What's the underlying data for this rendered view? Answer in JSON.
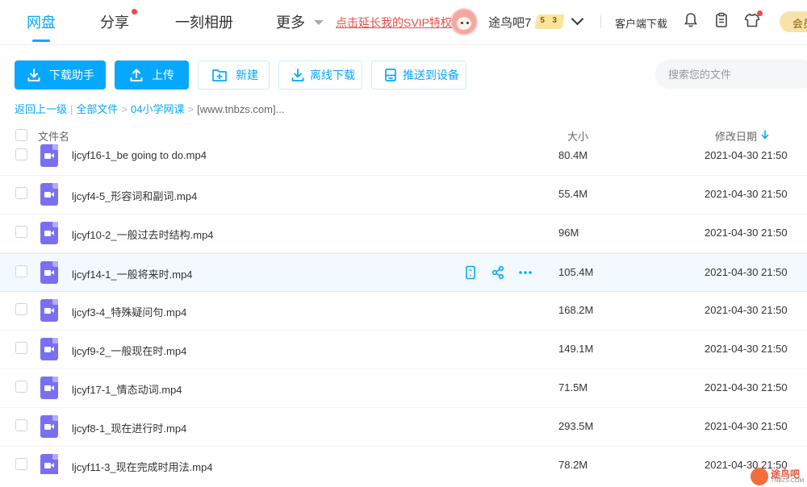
{
  "nav": {
    "items": [
      "网盘",
      "分享",
      "一刻相册",
      "更多"
    ],
    "svip_link": "点击延长我的SVIP特权"
  },
  "user": {
    "name": "途鸟吧7",
    "badge_level_a": "5",
    "badge_level_b": "3"
  },
  "header": {
    "client_download": "客户端下载",
    "member_label": "会员"
  },
  "toolbar": {
    "download_helper": "下载助手",
    "upload": "上传",
    "new": "新建",
    "offline_download": "离线下载",
    "push_device": "推送到设备"
  },
  "search": {
    "placeholder": "搜索您的文件"
  },
  "breadcrumb": {
    "back": "返回上一级",
    "all_files": "全部文件",
    "folder": "04小学网课",
    "current": "[www.tnbzs.com]..."
  },
  "columns": {
    "name": "文件名",
    "size": "大小",
    "modified": "修改日期"
  },
  "files": [
    {
      "name": "ljcyf16-1_be going to do.mp4",
      "size": "80.4M",
      "date": "2021-04-30 21:50"
    },
    {
      "name": "ljcyf4-5_形容词和副词.mp4",
      "size": "55.4M",
      "date": "2021-04-30 21:50"
    },
    {
      "name": "ljcyf10-2_一般过去时结构.mp4",
      "size": "96M",
      "date": "2021-04-30 21:50"
    },
    {
      "name": "ljcyf14-1_一般将来时.mp4",
      "size": "105.4M",
      "date": "2021-04-30 21:50"
    },
    {
      "name": "ljcyf3-4_特殊疑问句.mp4",
      "size": "168.2M",
      "date": "2021-04-30 21:50"
    },
    {
      "name": "ljcyf9-2_一般现在时.mp4",
      "size": "149.1M",
      "date": "2021-04-30 21:50"
    },
    {
      "name": "ljcyf17-1_情态动词.mp4",
      "size": "71.5M",
      "date": "2021-04-30 21:50"
    },
    {
      "name": "ljcyf8-1_现在进行时.mp4",
      "size": "293.5M",
      "date": "2021-04-30 21:50"
    },
    {
      "name": "ljcyf11-3_现在完成时用法.mp4",
      "size": "78.2M",
      "date": "2021-04-30 21:50"
    }
  ],
  "watermark": {
    "text": "途鸟吧",
    "sub": "TNBZS.COM"
  },
  "colors": {
    "accent": "#06a7ff",
    "svip_red": "#f04848",
    "video_icon": "#7a6ff0"
  }
}
